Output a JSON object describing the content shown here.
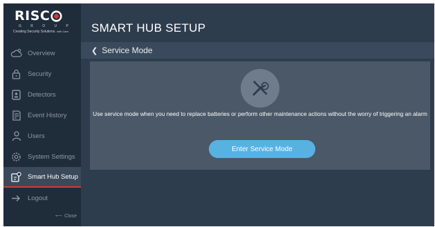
{
  "brand": {
    "name": "RISC",
    "group": "G R O U P",
    "tagline": "Creating Security Solutions.",
    "tagline_small": "with Care.",
    "accent": "#d23b3b"
  },
  "sidebar": {
    "items": [
      {
        "label": "Overview",
        "icon": "weather-icon"
      },
      {
        "label": "Security",
        "icon": "lock-icon"
      },
      {
        "label": "Detectors",
        "icon": "detector-icon"
      },
      {
        "label": "Event History",
        "icon": "history-icon"
      },
      {
        "label": "Users",
        "icon": "users-icon"
      },
      {
        "label": "System Settings",
        "icon": "gear-icon"
      },
      {
        "label": "Smart Hub Setup",
        "icon": "hub-setup-icon",
        "active": true
      },
      {
        "label": "Logout",
        "icon": "logout-icon"
      }
    ],
    "close_label": "Close"
  },
  "header": {
    "title": "SMART HUB SETUP"
  },
  "subheader": {
    "back_label": "Service Mode"
  },
  "service": {
    "icon": "tools-icon",
    "description": "Use service mode when you need to replace batteries or perform other maintenance actions without the worry of triggering an alarm",
    "button_label": "Enter Service Mode",
    "button_color": "#57b2e2"
  }
}
